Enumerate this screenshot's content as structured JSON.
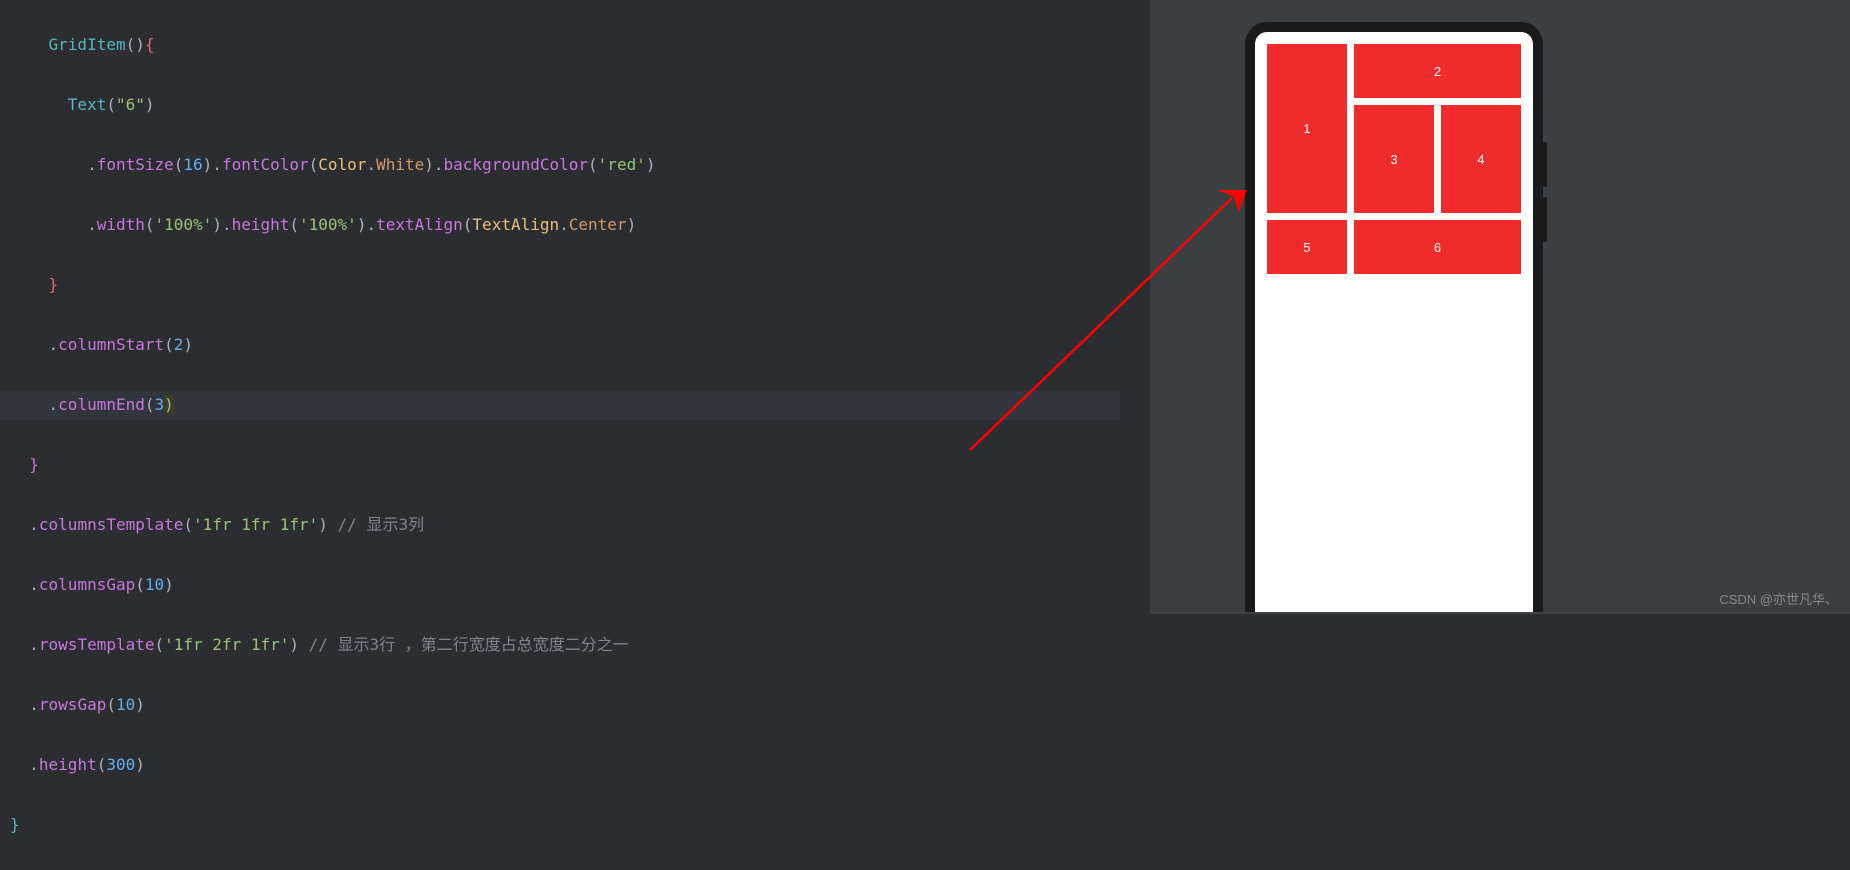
{
  "code": {
    "l01_a": "    GridItem",
    "l01_b": "()",
    "l01_c": "{",
    "l02_a": "      Text",
    "l02_b": "(",
    "l02_c": "\"6\"",
    "l02_d": ")",
    "l03_a": "        .",
    "l03_b": "fontSize",
    "l03_c": "(",
    "l03_d": "16",
    "l03_e": ").",
    "l03_f": "fontColor",
    "l03_g": "(",
    "l03_h": "Color",
    "l03_i": ".",
    "l03_j": "White",
    "l03_k": ").",
    "l03_l": "backgroundColor",
    "l03_m": "(",
    "l03_n": "'red'",
    "l03_o": ")",
    "l04_a": "        .",
    "l04_b": "width",
    "l04_c": "(",
    "l04_d": "'100%'",
    "l04_e": ").",
    "l04_f": "height",
    "l04_g": "(",
    "l04_h": "'100%'",
    "l04_i": ").",
    "l04_j": "textAlign",
    "l04_k": "(",
    "l04_l": "TextAlign",
    "l04_m": ".",
    "l04_n": "Center",
    "l04_o": ")",
    "l05": "    }",
    "l06_a": "    .",
    "l06_b": "columnStart",
    "l06_c": "(",
    "l06_d": "2",
    "l06_e": ")",
    "l07_a": "    .",
    "l07_b": "columnEnd",
    "l07_c": "(",
    "l07_d": "3",
    "l07_e": ")",
    "l08": "  }",
    "l09_a": "  .",
    "l09_b": "columnsTemplate",
    "l09_c": "(",
    "l09_d": "'1fr 1fr 1fr'",
    "l09_e": ") ",
    "l09_f": "// 显示3列",
    "l10_a": "  .",
    "l10_b": "columnsGap",
    "l10_c": "(",
    "l10_d": "10",
    "l10_e": ")",
    "l11_a": "  .",
    "l11_b": "rowsTemplate",
    "l11_c": "(",
    "l11_d": "'1fr 2fr 1fr'",
    "l11_e": ") ",
    "l11_f": "// 显示3行 ，第二行宽度占总宽度二分之一",
    "l12_a": "  .",
    "l12_b": "rowsGap",
    "l12_c": "(",
    "l12_d": "10",
    "l12_e": ")",
    "l13_a": "  .",
    "l13_b": "height",
    "l13_c": "(",
    "l13_d": "300",
    "l13_e": ")",
    "l14": "}"
  },
  "cells": {
    "c1": "1",
    "c2": "2",
    "c3": "3",
    "c4": "4",
    "c5": "5",
    "c6": "6"
  },
  "watermark": "CSDN @亦世凡华、"
}
